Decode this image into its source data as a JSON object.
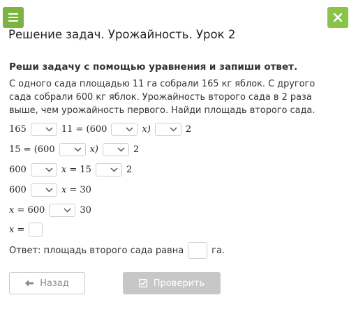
{
  "title": "Решение задач. Урожайность. Урок 2",
  "task": "Реши задачу с помощью уравнения и запиши ответ.",
  "problem": "С одного сада площадью 11 га собрали 165 кг яблок. С другого сада собрали 600 кг яблок. Урожайность второго сада в 2 раза выше, чем урожайность первого. Найди площадь второго сада.",
  "eq1": {
    "a": "165",
    "b": "11 = (600",
    "x": "x)",
    "c": "2"
  },
  "eq2": {
    "a": "15 = (600",
    "x": "x)",
    "c": "2"
  },
  "eq3": {
    "a": "600",
    "x": "x",
    "b": "= 15",
    "c": "2"
  },
  "eq4": {
    "a": "600",
    "x": "x",
    "b": "= 30"
  },
  "eq5": {
    "x": "x",
    "a": "= 600",
    "c": "30"
  },
  "eq6": {
    "x": "x",
    "a": "="
  },
  "answer": {
    "prefix": "Ответ: площадь второго сада равна",
    "suffix": "га."
  },
  "buttons": {
    "back": "Назад",
    "check": "Проверить"
  },
  "colors": {
    "menu": "#7cb342",
    "close": "#8bc34a",
    "check_disabled": "#c7c7c7"
  },
  "icons": {
    "menu": "hamburger-icon",
    "close": "close-icon",
    "dropdown": "chevron-down-icon",
    "back": "arrow-left-icon",
    "check": "checkbox-icon"
  }
}
